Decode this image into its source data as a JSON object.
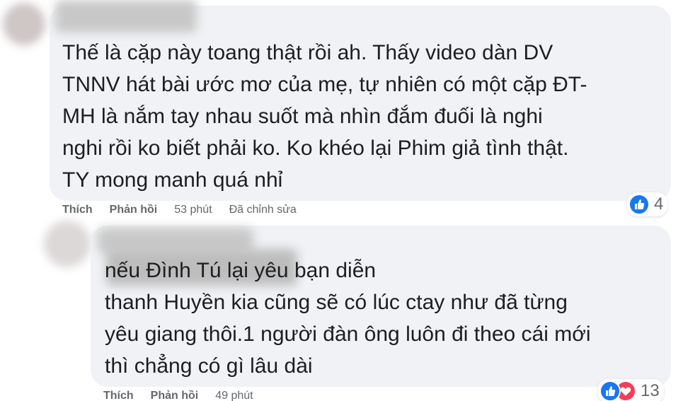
{
  "comments": [
    {
      "text": "Thế là cặp này toang thật rồi ah. Thấy video dàn DV\nTNNV hát bài ước mơ của mẹ, tự nhiên có một cặp ĐT-\nMH là nắm tay nhau suốt mà nhìn đắm đuối là nghi\nnghi rồi ko biết phải ko. Ko khéo lại Phim giả tình thật.\nTY mong manh quá nhỉ",
      "like_label": "Thích",
      "reply_label": "Phản hồi",
      "time": "53 phút",
      "edited": "Đã chỉnh sửa",
      "reaction_count": "4",
      "reaction_icons": [
        "like-icon"
      ]
    },
    {
      "text": "nếu Đình Tú lại yêu bạn diễn\nthanh Huyền kia cũng sẽ có lúc ctay như đã từng\nyêu giang thôi.1 người đàn ông luôn đi theo cái mới\nthì chẳng có gì lâu dài",
      "like_label": "Thích",
      "reply_label": "Phản hồi",
      "time": "49 phút",
      "reaction_count": "13",
      "reaction_icons": [
        "like-icon",
        "love-icon"
      ]
    }
  ],
  "colors": {
    "bubble": "#f0f2f5",
    "text": "#1c1e21",
    "meta": "#65676b",
    "like": "#1877f2",
    "love": "#f33e58"
  }
}
